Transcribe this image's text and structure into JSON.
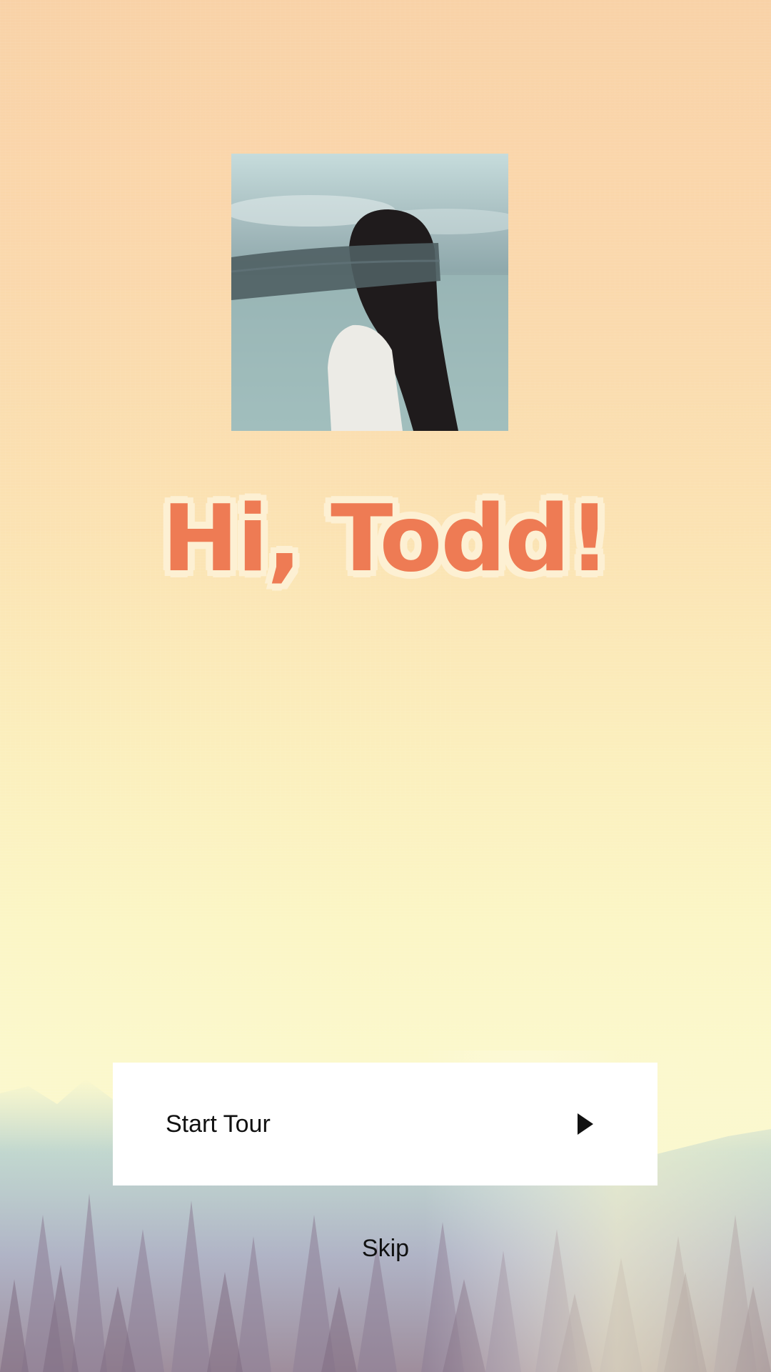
{
  "welcome": {
    "greeting": "Hi, Todd!",
    "avatar_icon": "profile-photo"
  },
  "actions": {
    "start_tour_label": "Start Tour",
    "start_tour_icon": "play-icon",
    "skip_label": "Skip"
  },
  "colors": {
    "greeting_text": "#ee7b54",
    "greeting_outline": "#fdf0d3",
    "button_background": "#ffffff"
  }
}
